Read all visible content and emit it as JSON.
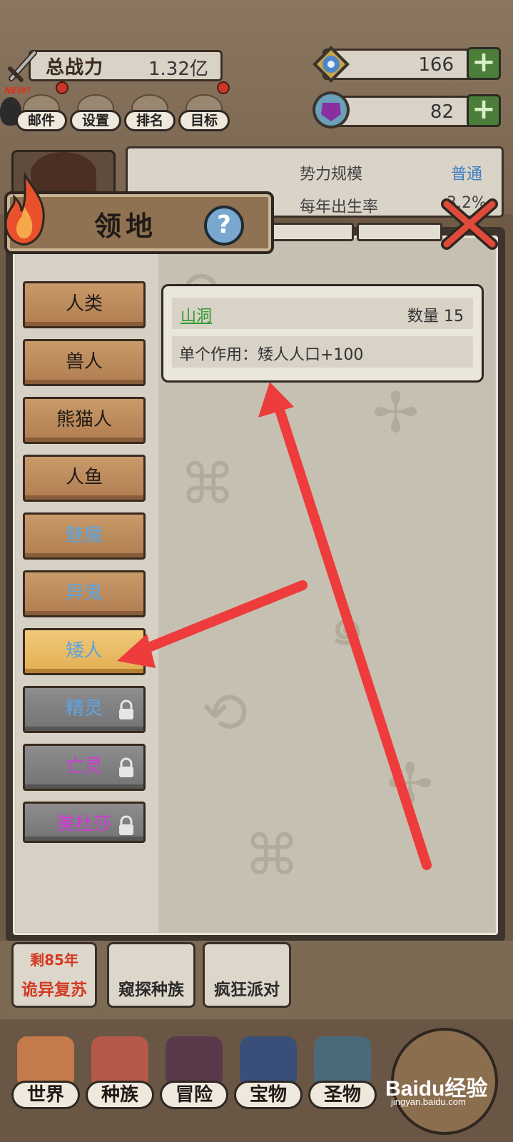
{
  "hud": {
    "power_label": "总战力",
    "power_value": "1.32亿",
    "resource_1_value": "166",
    "resource_2_value": "82",
    "plus_symbol": "+",
    "new_badge": "NEW!",
    "buttons": [
      {
        "label": "邮件",
        "icon": "mail-icon"
      },
      {
        "label": "设置",
        "icon": "gear-icon"
      },
      {
        "label": "排名",
        "icon": "ranking-icon"
      },
      {
        "label": "目标",
        "icon": "goal-icon"
      }
    ]
  },
  "info": {
    "scale_label": "势力规模",
    "scale_value": "普通",
    "birth_label": "每年出生率",
    "birth_value": "3.2%"
  },
  "modal": {
    "title": "领地",
    "help_symbol": "?",
    "races": [
      {
        "label": "人类",
        "color": "#1f1a16",
        "state": "normal"
      },
      {
        "label": "兽人",
        "color": "#1f1a16",
        "state": "normal"
      },
      {
        "label": "熊猫人",
        "color": "#1f1a16",
        "state": "normal"
      },
      {
        "label": "人鱼",
        "color": "#1f1a16",
        "state": "normal"
      },
      {
        "label": "魅魔",
        "color": "#5aa5e0",
        "state": "normal"
      },
      {
        "label": "异鬼",
        "color": "#5aa5e0",
        "state": "normal"
      },
      {
        "label": "矮人",
        "color": "#5aa5e0",
        "state": "selected"
      },
      {
        "label": "精灵",
        "color": "#5aa5e0",
        "state": "locked"
      },
      {
        "label": "亡灵",
        "color": "#d23ad6",
        "state": "locked"
      },
      {
        "label": "美杜莎",
        "color": "#d23ad6",
        "state": "locked"
      }
    ],
    "card": {
      "building_name": "山洞",
      "count_label": "数量 15",
      "effect": "单个作用：矮人人口+100"
    }
  },
  "events": [
    {
      "label": "诡异复苏",
      "sub": "剩85年",
      "label_color": "#d33a25"
    },
    {
      "label": "窥探种族",
      "sub": "",
      "label_color": "#2a2a2a"
    },
    {
      "label": "疯狂派对",
      "sub": "",
      "label_color": "#2a2a2a"
    }
  ],
  "nav": [
    {
      "label": "世界"
    },
    {
      "label": "种族"
    },
    {
      "label": "冒险"
    },
    {
      "label": "宝物"
    },
    {
      "label": "圣物"
    }
  ],
  "watermark": {
    "main": "Baidu经验",
    "sub": "jingyan.baidu.com"
  },
  "colors": {
    "annotation_arrow": "#ee3b3b",
    "accent_blue": "#3d7fbf"
  }
}
